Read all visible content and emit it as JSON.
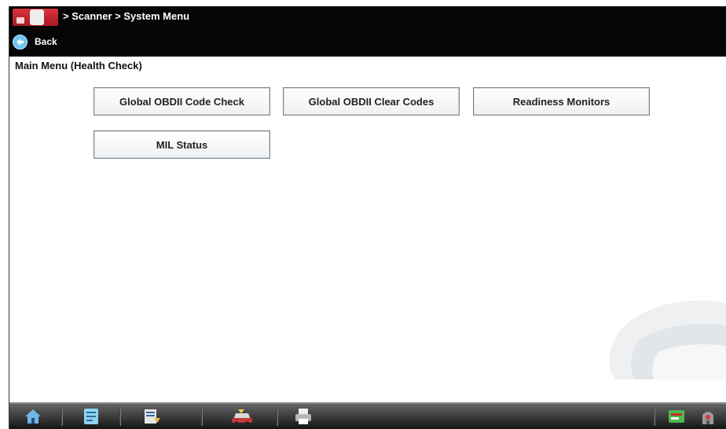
{
  "header": {
    "breadcrumb": "> Scanner  > System Menu",
    "back_label": "Back",
    "logo_icon": "scanner-logo-icon",
    "back_icon": "back-arrow-icon"
  },
  "main": {
    "title": "Main Menu (Health Check)",
    "buttons": [
      {
        "label": "Global OBDII Code Check"
      },
      {
        "label": "Global OBDII Clear Codes"
      },
      {
        "label": "Readiness Monitors"
      },
      {
        "label": "MIL Status"
      }
    ]
  },
  "taskbar": {
    "icons": [
      "home-icon",
      "notes-icon",
      "data-icon",
      "vehicle-icon",
      "printer-icon",
      "tools-icon",
      "connection-icon"
    ]
  },
  "colors": {
    "header_bg": "#050505",
    "button_border": "#7c8389",
    "back_icon": "#6cc6ef"
  }
}
